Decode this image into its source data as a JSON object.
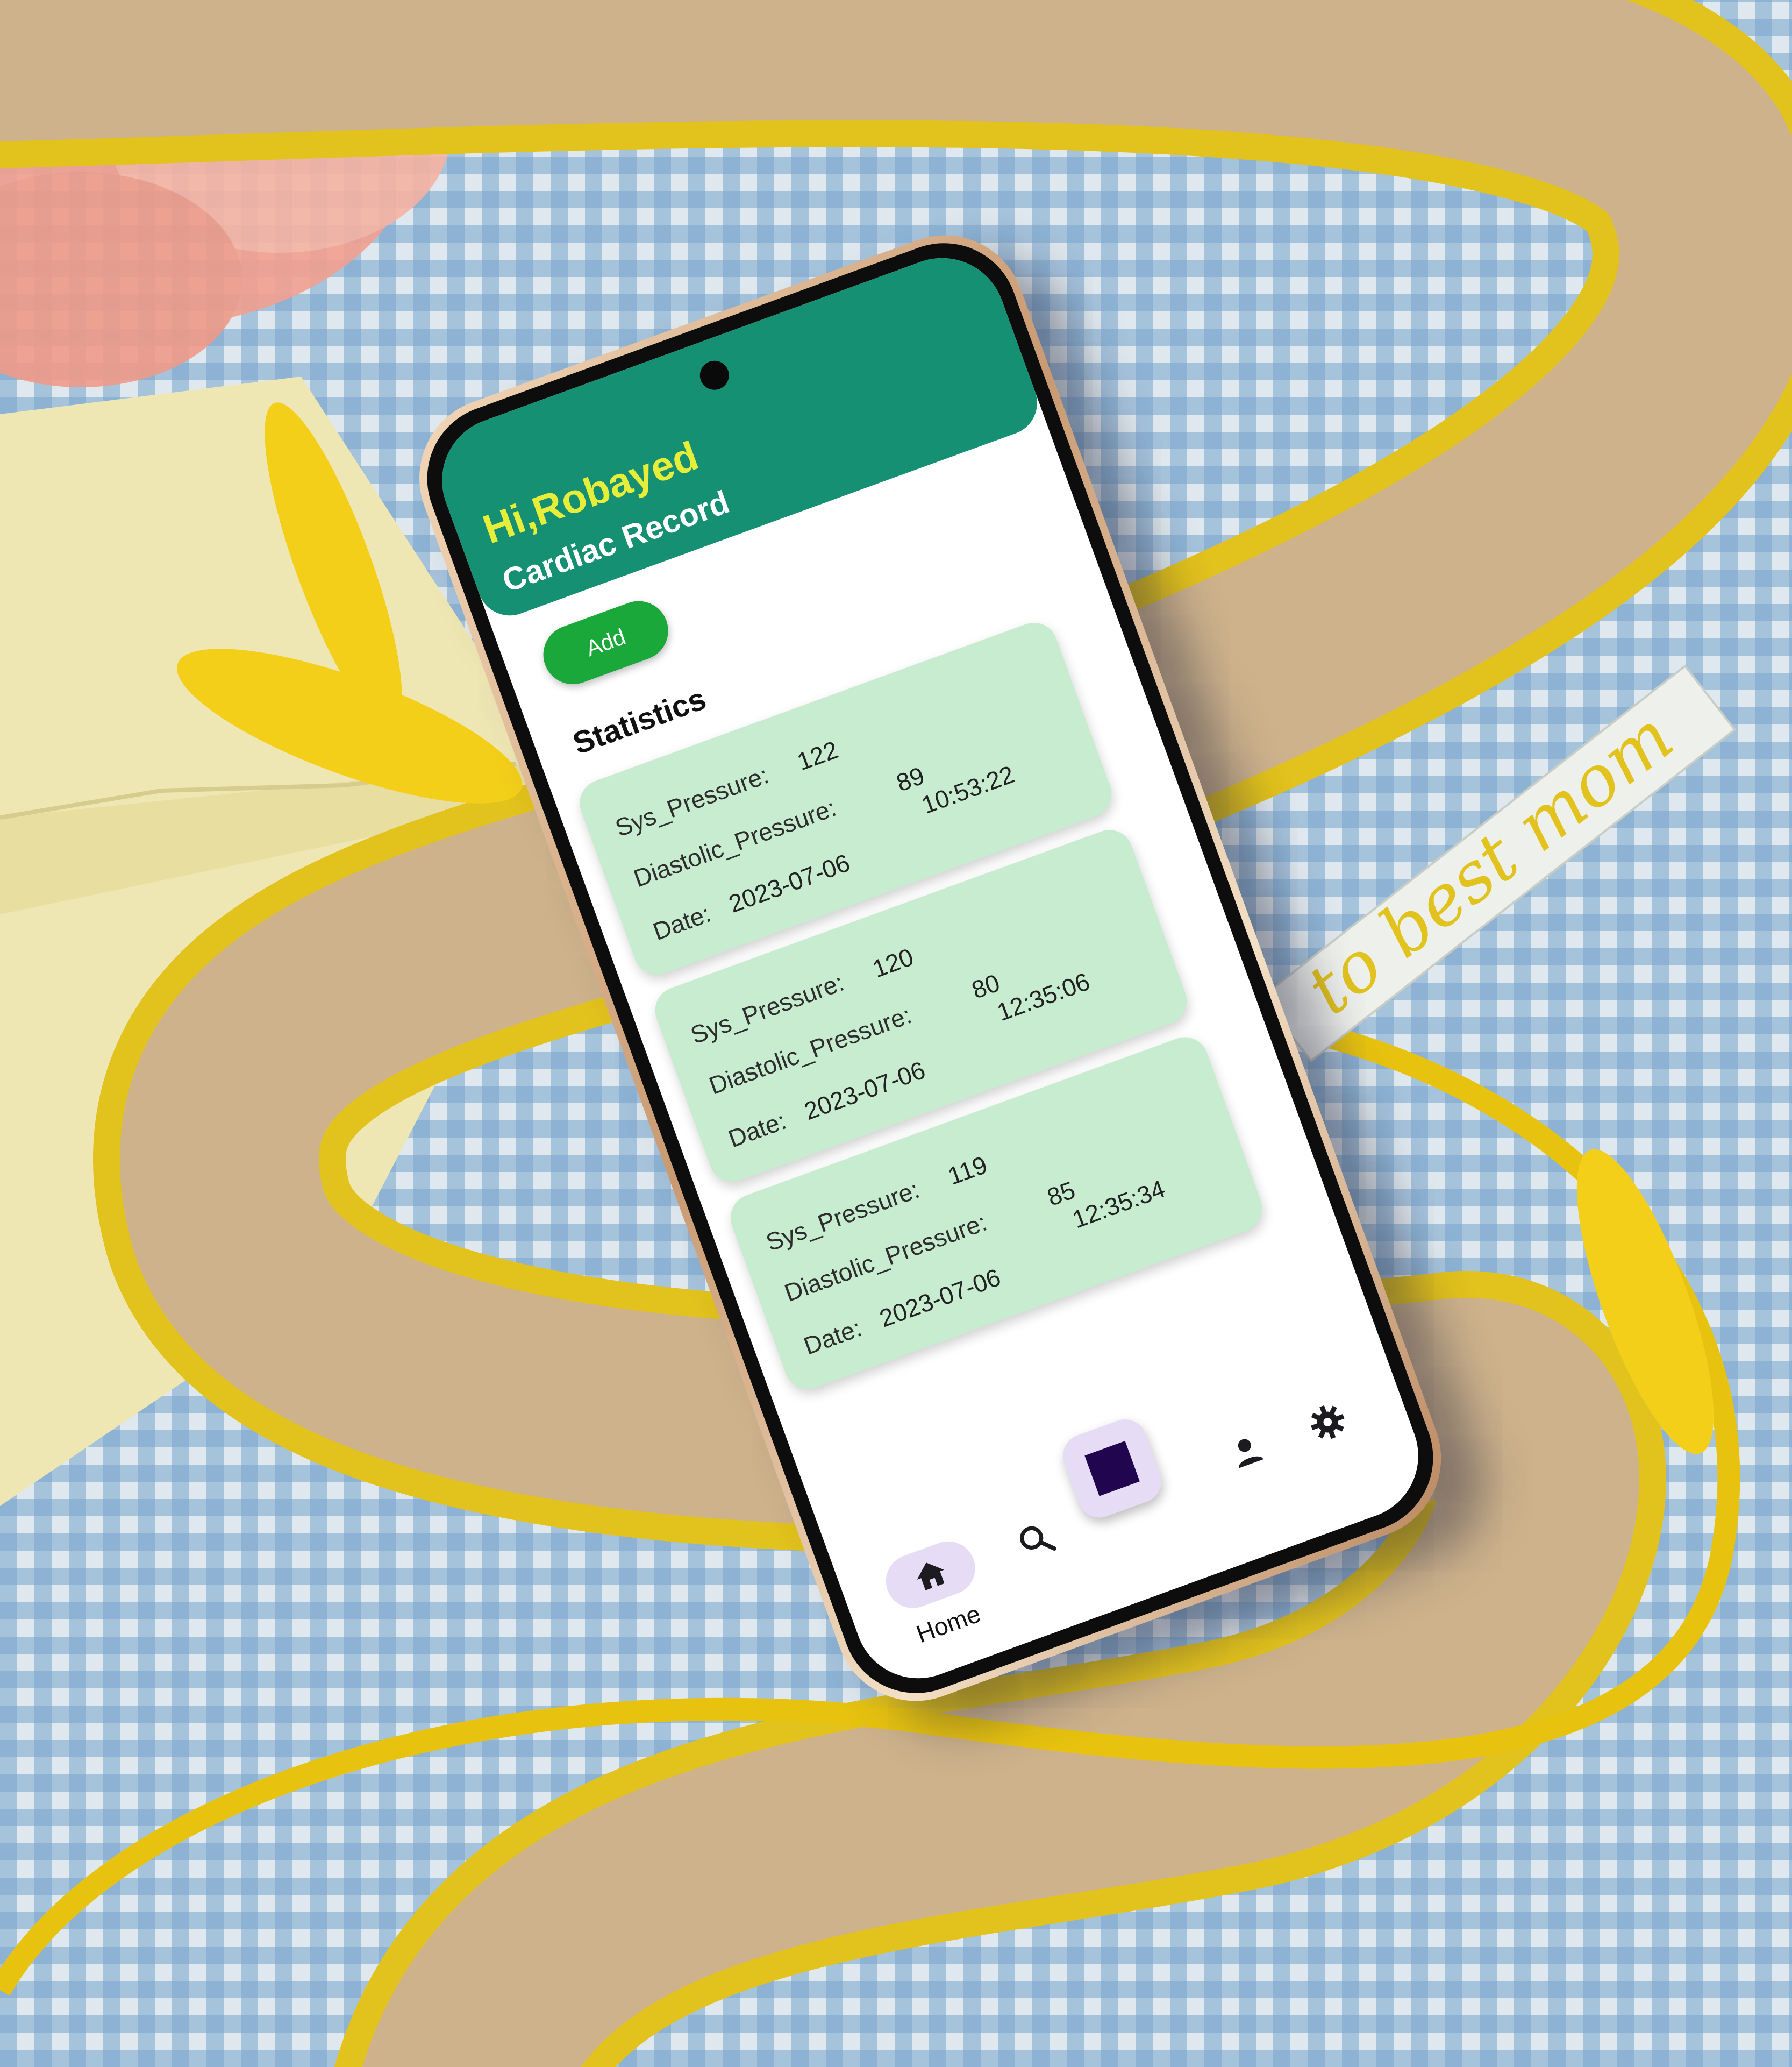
{
  "app": {
    "greeting": "Hi,Robayed",
    "section_title": "Cardiac Record"
  },
  "actions": {
    "add_label": "Add"
  },
  "statistics": {
    "title": "Statistics",
    "records": [
      {
        "sys_label": "Sys_Pressure:",
        "sys_value": "122",
        "diastolic_label": "Diastolic_Pressure:",
        "diastolic_value": "89",
        "date_label": "Date:",
        "date_value": "2023-07-06",
        "time_value": "10:53:22"
      },
      {
        "sys_label": "Sys_Pressure:",
        "sys_value": "120",
        "diastolic_label": "Diastolic_Pressure:",
        "diastolic_value": "80",
        "date_label": "Date:",
        "date_value": "2023-07-06",
        "time_value": "12:35:06"
      },
      {
        "sys_label": "Sys_Pressure:",
        "sys_value": "119",
        "diastolic_label": "Diastolic_Pressure:",
        "diastolic_value": "85",
        "date_label": "Date:",
        "date_value": "2023-07-06",
        "time_value": "12:35:34"
      }
    ]
  },
  "bottom_nav": {
    "items": [
      {
        "label": "Home",
        "icon": "home-icon",
        "active": true
      },
      {
        "label": "",
        "icon": "search-icon"
      },
      {
        "label": "",
        "icon": "square-icon"
      },
      {
        "label": "",
        "icon": "person-icon"
      },
      {
        "label": "",
        "icon": "gear-icon"
      }
    ]
  },
  "decor": {
    "ribbon_text": "to best mom",
    "colors": {
      "header_green": "#159073",
      "greeting_yellow": "#e6ee3a",
      "card_green": "#c8ecd0",
      "add_button_green": "#1aa83a",
      "nav_pill_lavender": "#e6dcf6",
      "center_square": "#21064f"
    }
  }
}
